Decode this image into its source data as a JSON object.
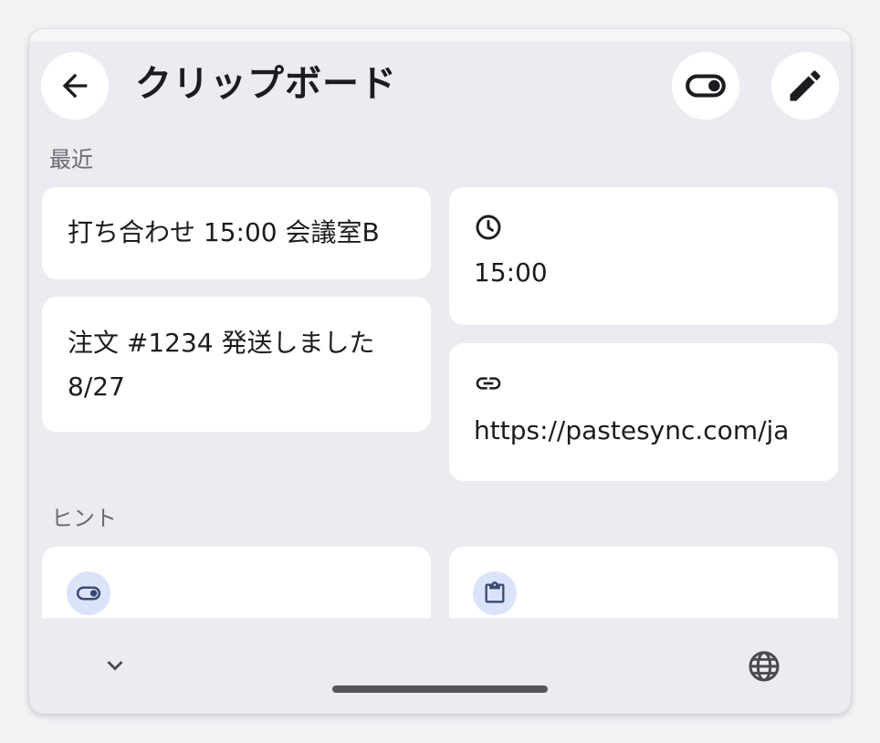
{
  "header": {
    "title": "クリップボード"
  },
  "sections": {
    "recent_label": "最近",
    "hints_label": "ヒント"
  },
  "recent_items": [
    {
      "text": "打ち合わせ 15:00 会議室B"
    },
    {
      "text": "注文 #1234 発送しました 8/27"
    },
    {
      "icon": "clock-icon",
      "text": "15:00"
    },
    {
      "icon": "link-icon",
      "text": "https://pastesync.com/ja"
    }
  ],
  "hints": [
    {
      "icon": "toggle-icon"
    },
    {
      "icon": "clipboard-icon"
    }
  ],
  "icons": {
    "back": "arrow-back-icon",
    "toggle": "toggle-icon",
    "edit": "pencil-icon",
    "collapse": "chevron-down-icon",
    "language": "globe-icon"
  },
  "colors": {
    "sheet_background": "#ecebf1",
    "card_background": "#ffffff",
    "text_primary": "#1d1b20",
    "text_secondary": "#6b6a72",
    "hint_icon_background": "#dbe3fb",
    "hint_icon_color": "#3b4a75"
  }
}
